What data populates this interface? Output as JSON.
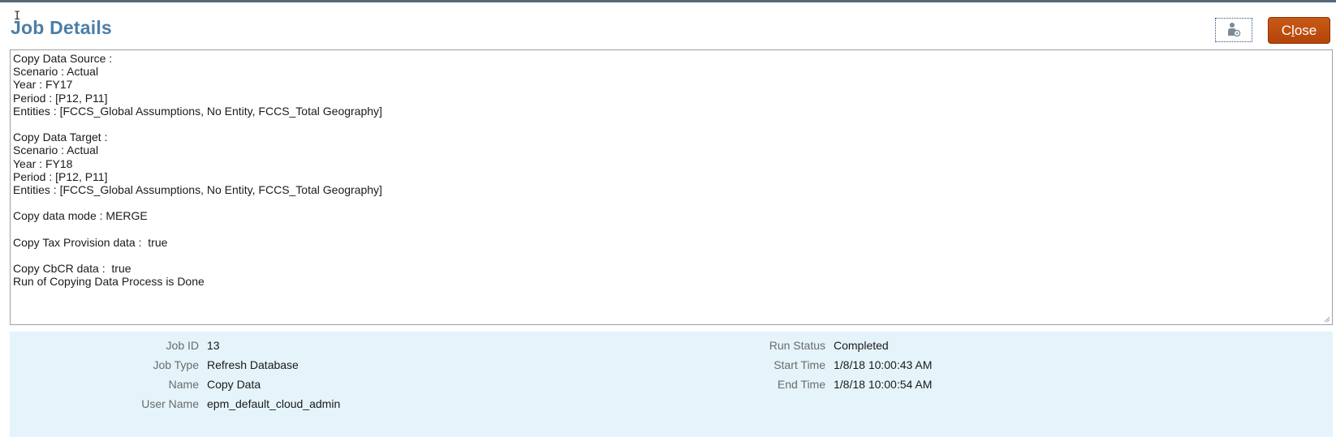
{
  "dialog": {
    "title": "Job Details",
    "close_label": "Close",
    "close_hotkey": "l",
    "icon_button": "user-settings-icon"
  },
  "log": {
    "lines": [
      "Copy Data Source :",
      "Scenario : Actual",
      "Year : FY17",
      "Period : [P12, P11]",
      "Entities : [FCCS_Global Assumptions, No Entity, FCCS_Total Geography]",
      "",
      "Copy Data Target :",
      "Scenario : Actual",
      "Year : FY18",
      "Period : [P12, P11]",
      "Entities : [FCCS_Global Assumptions, No Entity, FCCS_Total Geography]",
      "",
      "Copy data mode : MERGE",
      "",
      "Copy Tax Provision data :  true",
      "",
      "Copy CbCR data :  true",
      "Run of Copying Data Process is Done"
    ]
  },
  "details": {
    "left": [
      {
        "label": "Job ID",
        "value": "13"
      },
      {
        "label": "Job Type",
        "value": "Refresh Database"
      },
      {
        "label": "Name",
        "value": "Copy Data"
      },
      {
        "label": "User Name",
        "value": "epm_default_cloud_admin"
      }
    ],
    "right": [
      {
        "label": "Run Status",
        "value": "Completed"
      },
      {
        "label": "Start Time",
        "value": "1/8/18 10:00:43 AM"
      },
      {
        "label": "End Time",
        "value": "1/8/18 10:00:54 AM"
      }
    ]
  },
  "colors": {
    "title": "#4a7ea8",
    "close_button": "#b54408",
    "info_panel_bg": "#e5f4fb",
    "top_strip": "#56697a"
  }
}
